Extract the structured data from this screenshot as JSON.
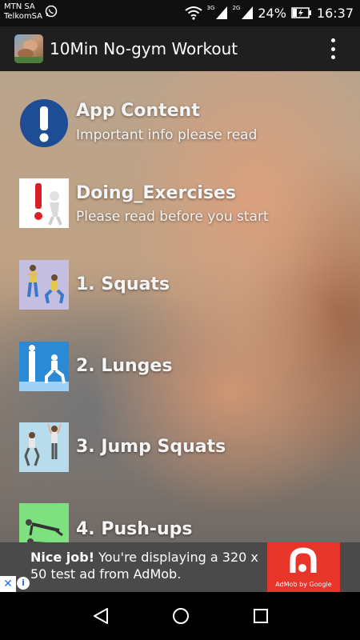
{
  "status_bar": {
    "carrier_line1": "MTN SA",
    "carrier_line2": "TelkomSA",
    "network1": "3G",
    "network2": "2G",
    "battery": "24%",
    "time": "16:37"
  },
  "app_bar": {
    "title": "10Min No-gym Workout"
  },
  "menu": {
    "items": [
      {
        "title": "App Content",
        "subtitle": "Important info please read",
        "icon": "exclamation-icon"
      },
      {
        "title": "Doing_Exercises",
        "subtitle": "Please read before you start",
        "icon": "warning-figure-icon"
      },
      {
        "title": "1. Squats",
        "icon": "squats-thumbnail"
      },
      {
        "title": "2. Lunges",
        "icon": "lunges-thumbnail"
      },
      {
        "title": "3. Jump Squats",
        "icon": "jump-squats-thumbnail"
      },
      {
        "title": "4. Push-ups",
        "icon": "pushups-thumbnail"
      }
    ]
  },
  "ad": {
    "bold_text": "Nice job!",
    "body_text": " You're displaying a 320 x 50 test ad from AdMob.",
    "logo_label": "AdMob by Google",
    "close_glyph": "✕",
    "info_glyph": "i"
  },
  "colors": {
    "app_bar": "#1f1f1f",
    "ad_logo": "#e8352a",
    "exclamation_circle": "#1e4c95"
  }
}
